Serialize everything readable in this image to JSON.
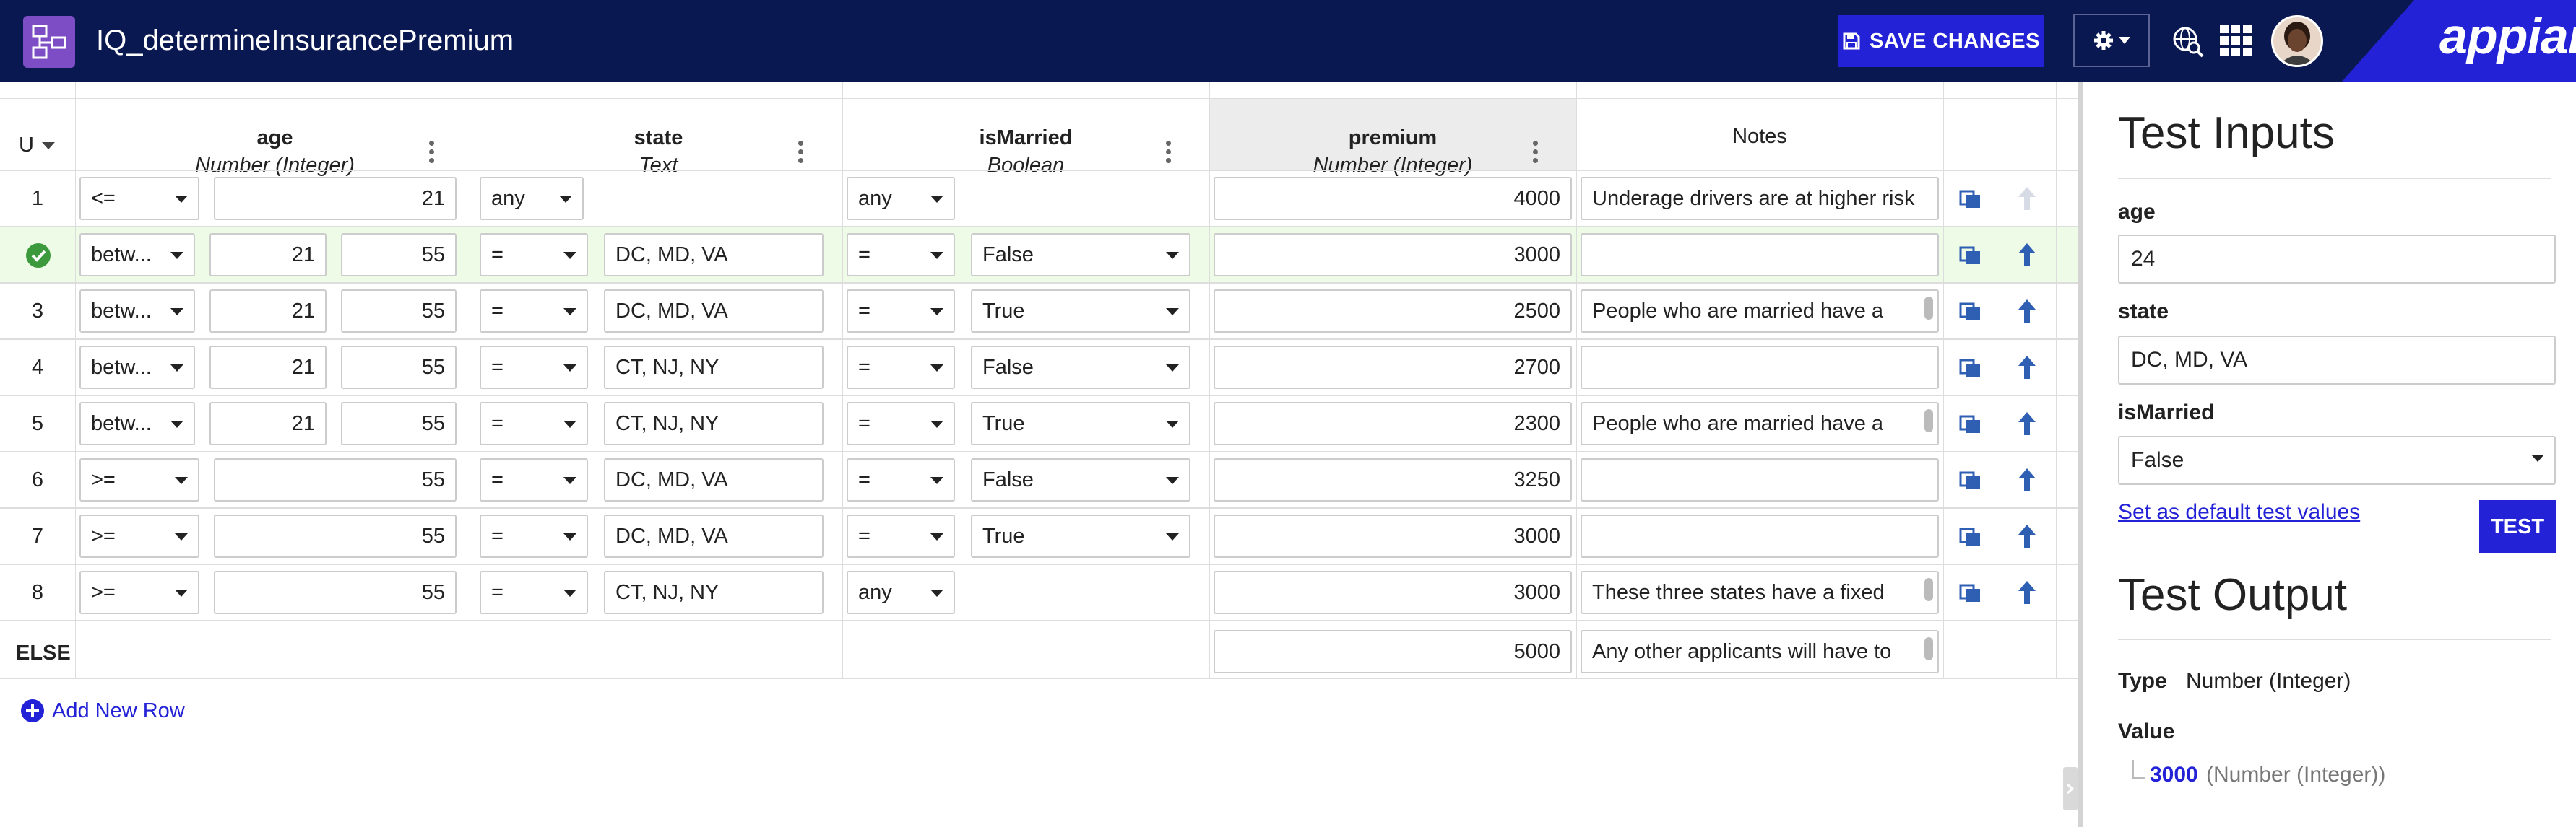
{
  "app": {
    "title": "IQ_determineInsurancePremium",
    "save_label": "SAVE CHANGES",
    "brand": "appian"
  },
  "table": {
    "u_header": "U",
    "columns": [
      {
        "name": "age",
        "type": "Number (Integer)"
      },
      {
        "name": "state",
        "type": "Text"
      },
      {
        "name": "isMarried",
        "type": "Boolean"
      },
      {
        "name": "premium",
        "type": "Number (Integer)"
      },
      {
        "name": "Notes",
        "type": ""
      }
    ],
    "rows": [
      {
        "num": "1",
        "age_op": "<=",
        "age_a": "",
        "age_b": "21",
        "state_op": "any",
        "state_val": "",
        "mar_op": "any",
        "mar_val": "",
        "premium": "4000",
        "notes": "Underage drivers are at higher risk"
      },
      {
        "num": "",
        "age_op": "betw...",
        "age_a": "21",
        "age_b": "55",
        "state_op": "=",
        "state_val": "DC, MD, VA",
        "mar_op": "=",
        "mar_val": "False",
        "premium": "3000",
        "notes": ""
      },
      {
        "num": "3",
        "age_op": "betw...",
        "age_a": "21",
        "age_b": "55",
        "state_op": "=",
        "state_val": "DC, MD, VA",
        "mar_op": "=",
        "mar_val": "True",
        "premium": "2500",
        "notes": "People who are married have a"
      },
      {
        "num": "4",
        "age_op": "betw...",
        "age_a": "21",
        "age_b": "55",
        "state_op": "=",
        "state_val": "CT, NJ, NY",
        "mar_op": "=",
        "mar_val": "False",
        "premium": "2700",
        "notes": ""
      },
      {
        "num": "5",
        "age_op": "betw...",
        "age_a": "21",
        "age_b": "55",
        "state_op": "=",
        "state_val": "CT, NJ, NY",
        "mar_op": "=",
        "mar_val": "True",
        "premium": "2300",
        "notes": "People who are married have a"
      },
      {
        "num": "6",
        "age_op": ">=",
        "age_a": "",
        "age_b": "55",
        "state_op": "=",
        "state_val": "DC, MD, VA",
        "mar_op": "=",
        "mar_val": "False",
        "premium": "3250",
        "notes": ""
      },
      {
        "num": "7",
        "age_op": ">=",
        "age_a": "",
        "age_b": "55",
        "state_op": "=",
        "state_val": "DC, MD, VA",
        "mar_op": "=",
        "mar_val": "True",
        "premium": "3000",
        "notes": ""
      },
      {
        "num": "8",
        "age_op": ">=",
        "age_a": "",
        "age_b": "55",
        "state_op": "=",
        "state_val": "CT, NJ, NY",
        "mar_op": "any",
        "mar_val": "",
        "premium": "3000",
        "notes": "These three states have a fixed"
      }
    ],
    "else_label": "ELSE",
    "else_premium": "5000",
    "else_notes": "Any other applicants will have to",
    "add_row_label": "Add New Row"
  },
  "panel": {
    "inputs_title": "Test Inputs",
    "age_label": "age",
    "age_value": "24",
    "state_label": "state",
    "state_value": "DC, MD, VA",
    "married_label": "isMarried",
    "married_value": "False",
    "default_link": "Set as default test values",
    "test_button": "TEST",
    "output_title": "Test Output",
    "type_label": "Type",
    "type_value": "Number (Integer)",
    "value_label": "Value",
    "value_number": "3000",
    "value_type": "(Number (Integer))"
  },
  "colors": {
    "topbar": "#0a1851",
    "accent": "#2322d6",
    "app_icon": "#7c4dc4",
    "matched_row": "#eefbe6",
    "check": "#3c9a3c"
  }
}
